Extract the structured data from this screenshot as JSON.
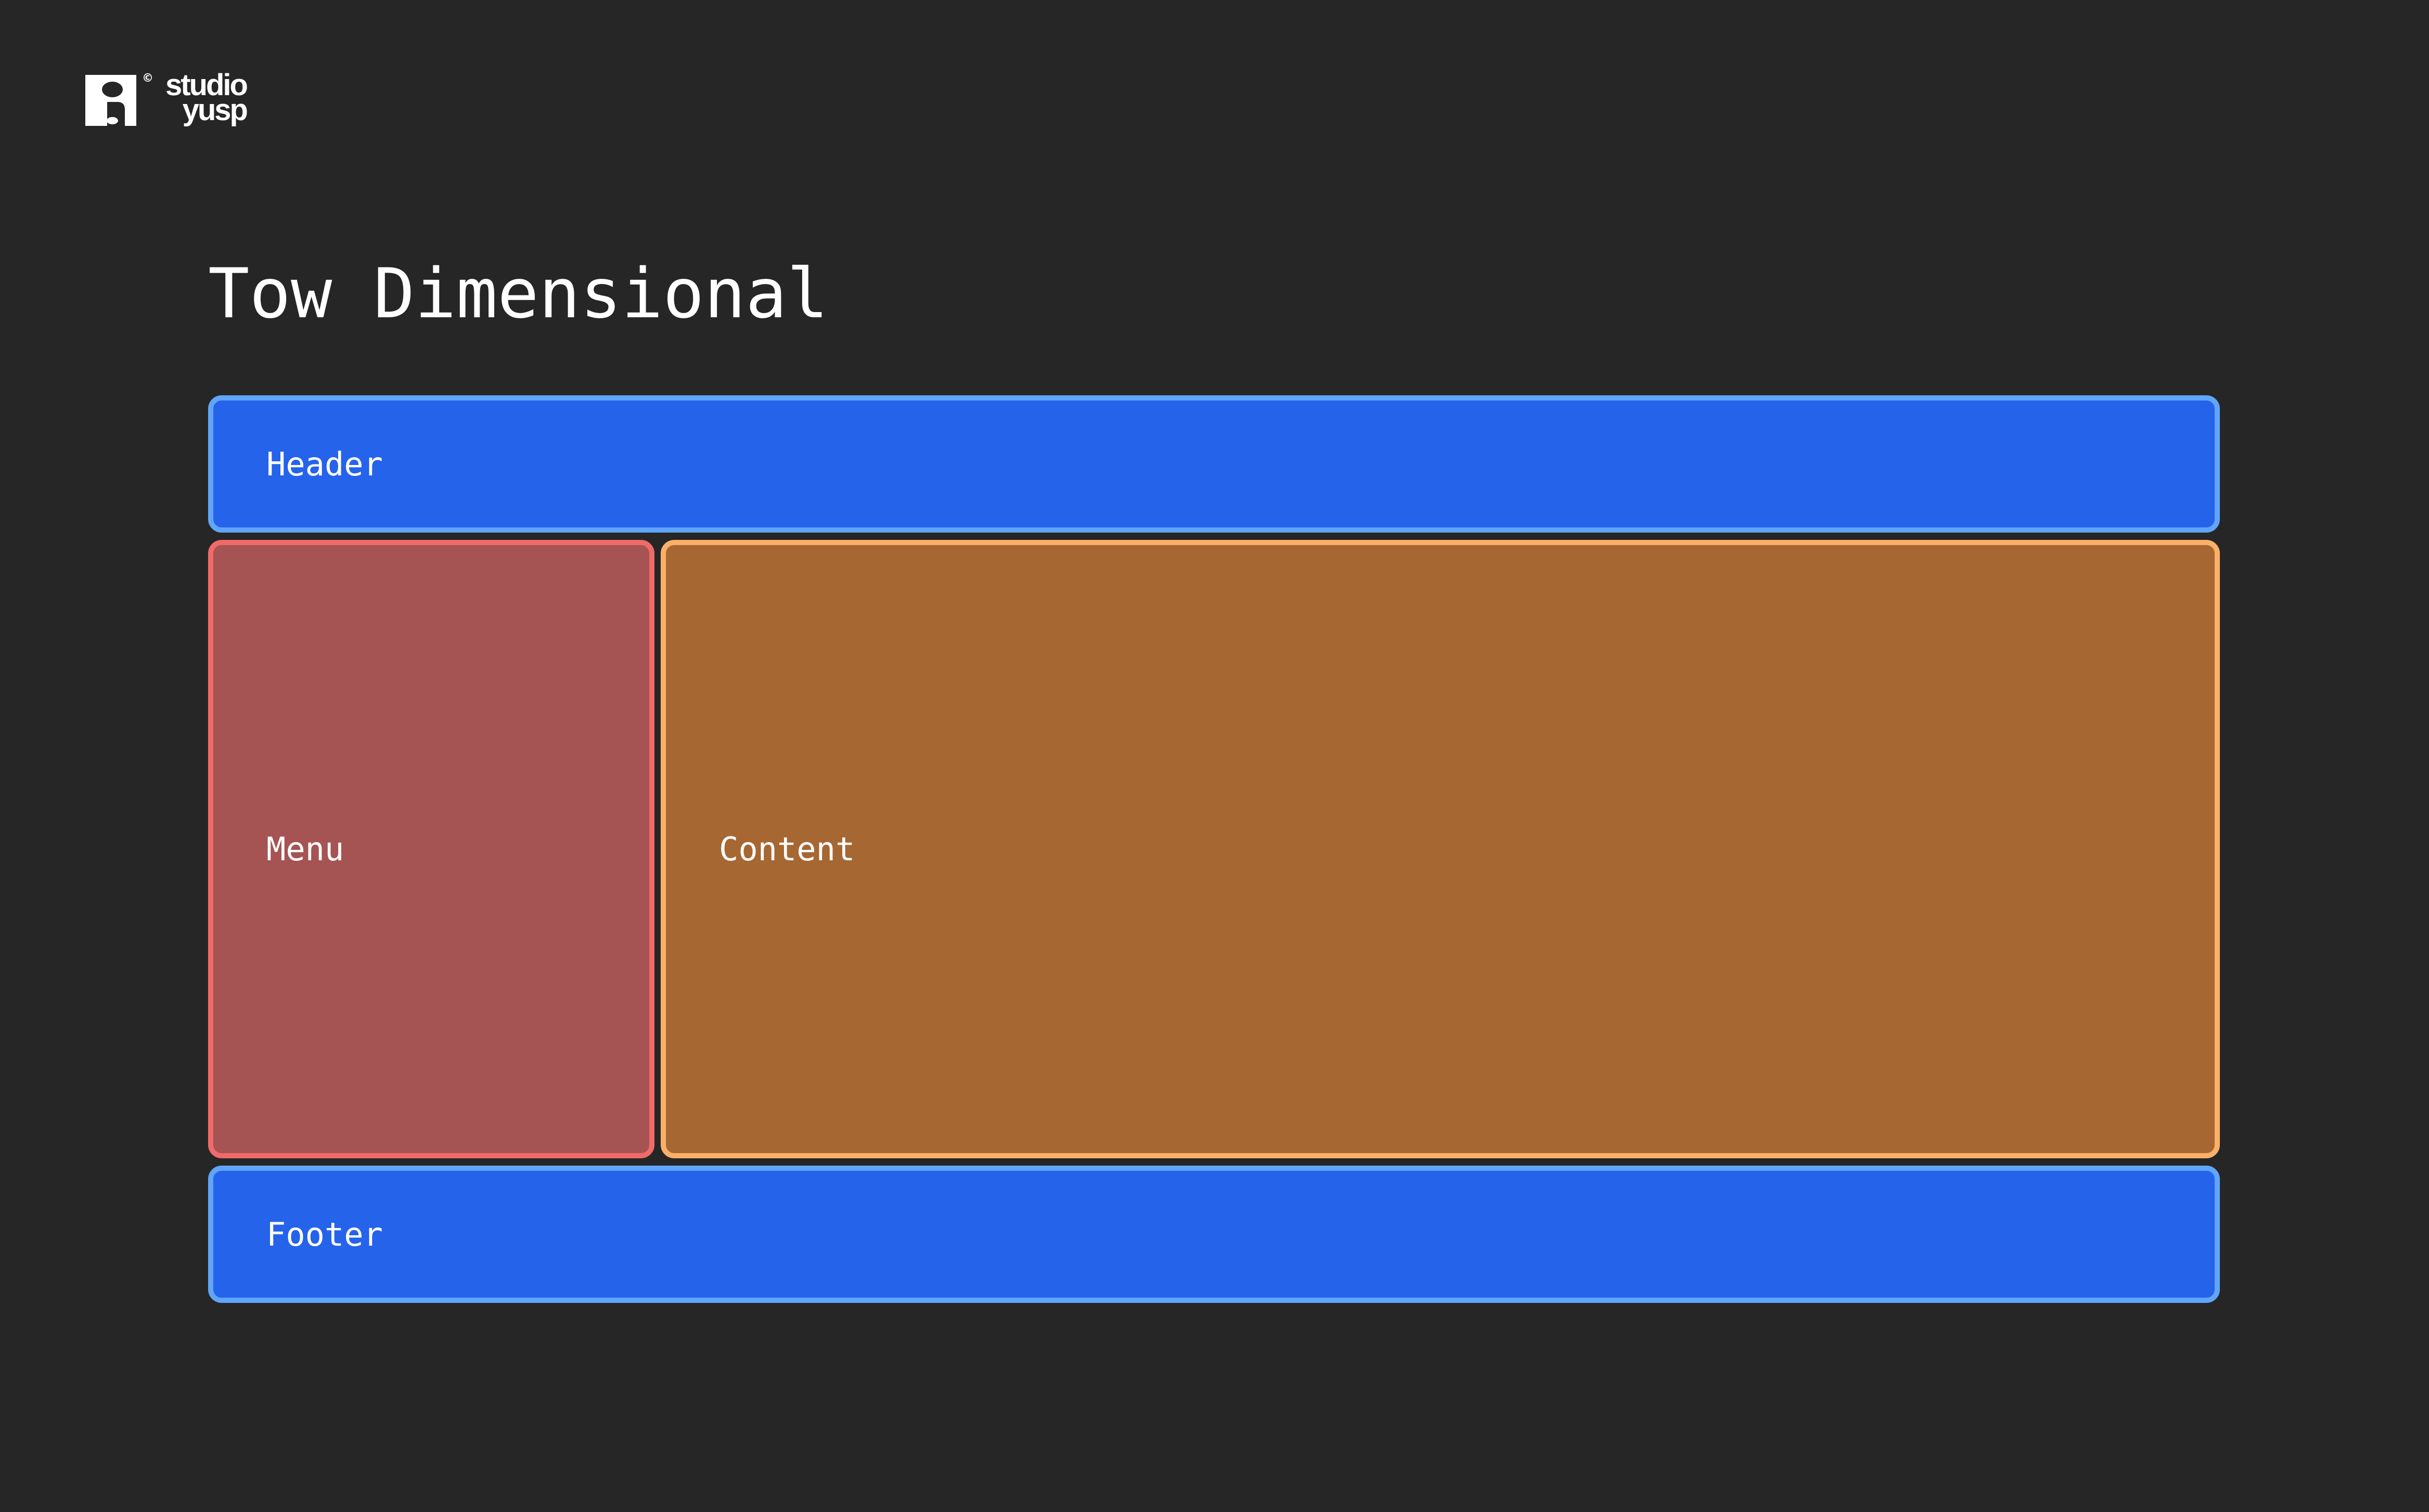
{
  "logo": {
    "copyright": "©",
    "line1": "studio",
    "line2": "yusp"
  },
  "title": "Tow Dimensional",
  "areas": {
    "header": {
      "label": "Header"
    },
    "menu": {
      "label": "Menu"
    },
    "content": {
      "label": "Content"
    },
    "footer": {
      "label": "Footer"
    }
  },
  "colors": {
    "background": "#262626",
    "header_fill": "#2563eb",
    "header_border": "#60a5fa",
    "menu_fill": "#a65353",
    "menu_border": "#f06a6a",
    "content_fill": "#a66733",
    "content_border": "#fbb069",
    "footer_fill": "#2563eb",
    "footer_border": "#60a5fa"
  }
}
